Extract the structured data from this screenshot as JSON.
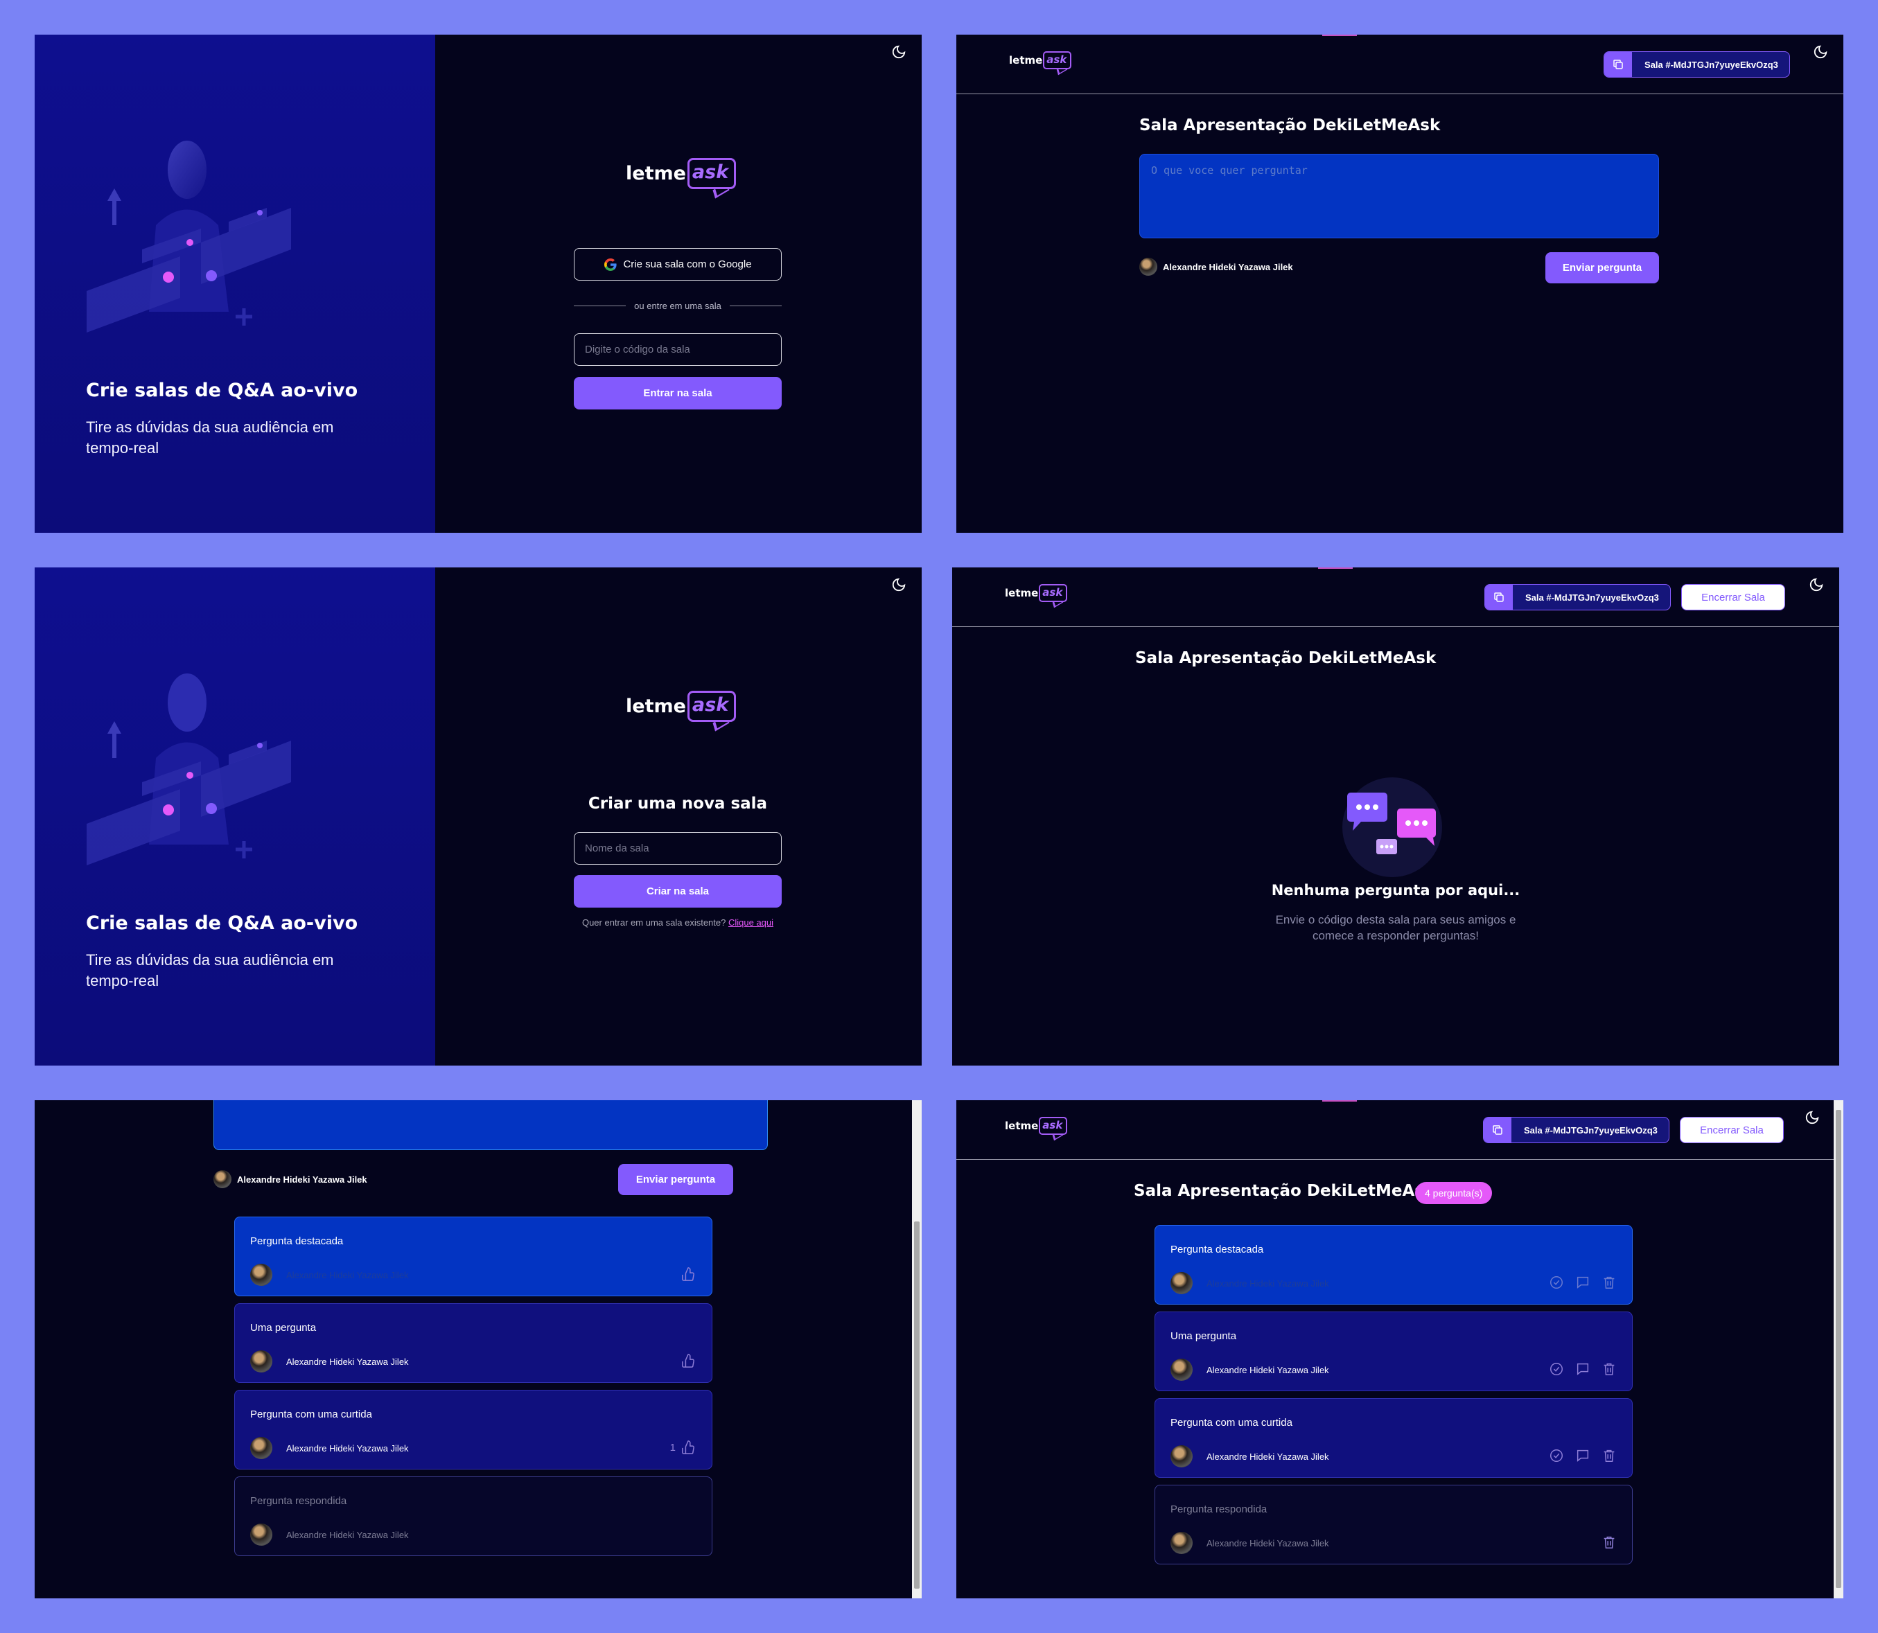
{
  "auth": {
    "hero_title": "Crie salas de Q&A ao-vivo",
    "hero_subtitle": "Tire as dúvidas da sua audiência em tempo-real",
    "logo_text": "letme",
    "logo_accent": "ask",
    "google_button": "Crie sua sala com o Google",
    "separator": "ou entre em uma sala",
    "room_code_placeholder": "Digite o código da sala",
    "join_button": "Entrar na sala",
    "new_room_title": "Criar uma nova sala",
    "room_name_placeholder": "Nome da sala",
    "create_button": "Criar na sala",
    "existing_prompt": "Quer entrar em uma sala existente?",
    "existing_link": "Clique aqui"
  },
  "room": {
    "code_label": "Sala #-MdJTGJn7yuyeEkvOzq3",
    "close_button": "Encerrar Sala",
    "title": "Sala Apresentação DekiLetMeAsk",
    "question_count": "4 pergunta(s)",
    "ask_placeholder": "O que voce quer perguntar",
    "user_name": "Alexandre Hideki Yazawa Jilek",
    "send_button": "Enviar pergunta",
    "empty_title": "Nenhuma pergunta por aqui...",
    "empty_sub_line1": "Envie o código desta sala para seus amigos e",
    "empty_sub_line2": "comece a responder perguntas!"
  },
  "questions": [
    {
      "text": "Pergunta destacada",
      "author": "Alexandre Hideki Yazawa Jilek",
      "state": "highlighted",
      "likes": ""
    },
    {
      "text": "Uma pergunta",
      "author": "Alexandre Hideki Yazawa Jilek",
      "state": "normal",
      "likes": ""
    },
    {
      "text": "Pergunta com uma curtida",
      "author": "Alexandre Hideki Yazawa Jilek",
      "state": "normal",
      "likes": "1"
    },
    {
      "text": "Pergunta respondida",
      "author": "Alexandre Hideki Yazawa Jilek",
      "state": "answered",
      "likes": ""
    }
  ],
  "colors": {
    "page_background": "#7a83f5",
    "app_background": "#04041c",
    "primary": "#835afd",
    "accent_pink": "#e559f9",
    "highlight_blue": "#0334c2",
    "card_navy": "#10107e"
  },
  "icons": {
    "theme": "moon-icon",
    "copy": "copy-icon",
    "like": "thumbs-up-icon",
    "check": "check-circle-icon",
    "answer": "chat-bubble-icon",
    "delete": "trash-icon",
    "google": "google-icon"
  }
}
